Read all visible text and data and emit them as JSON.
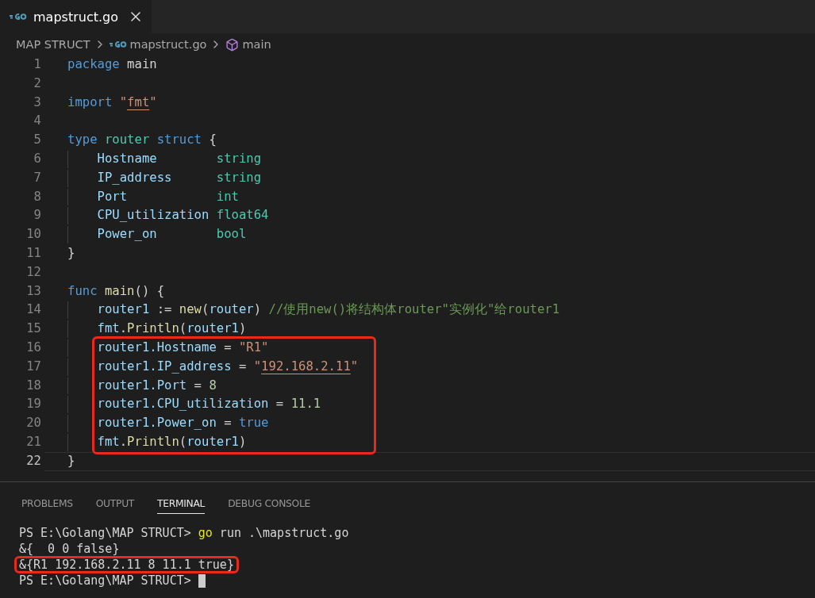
{
  "editor_tabs": [
    {
      "label": "mapstruct.go",
      "selected": true
    }
  ],
  "breadcrumb": [
    {
      "kind": "folder",
      "label": "MAP STRUCT"
    },
    {
      "kind": "file",
      "label": "mapstruct.go"
    },
    {
      "kind": "symbol",
      "label": "main"
    }
  ],
  "code_lines": [
    {
      "number": "1",
      "current": false,
      "highlighted": false,
      "tokens": [
        {
          "kind": "kw",
          "text": "package"
        },
        {
          "kind": "plain",
          "text": " main"
        }
      ]
    },
    {
      "number": "2",
      "current": false,
      "highlighted": false
    },
    {
      "number": "3",
      "current": false,
      "highlighted": false,
      "tokens": [
        {
          "kind": "kw",
          "text": "import "
        },
        {
          "kind": "str",
          "text": "\""
        },
        {
          "kind": "link",
          "text": "fmt"
        },
        {
          "kind": "str",
          "text": "\""
        }
      ]
    },
    {
      "number": "4",
      "current": false,
      "highlighted": false
    },
    {
      "number": "5",
      "current": false,
      "highlighted": false,
      "tokens": [
        {
          "kind": "kw",
          "text": "type "
        },
        {
          "kind": "type",
          "text": "router "
        },
        {
          "kind": "kw",
          "text": "struct"
        },
        {
          "kind": "plain",
          "text": " {"
        }
      ]
    },
    {
      "number": "6",
      "current": false,
      "highlighted": false,
      "tokens": [
        {
          "kind": "var",
          "text": "    Hostname        "
        },
        {
          "kind": "type",
          "text": "string"
        }
      ]
    },
    {
      "number": "7",
      "current": false,
      "highlighted": false,
      "tokens": [
        {
          "kind": "var",
          "text": "    IP_address      "
        },
        {
          "kind": "type",
          "text": "string"
        }
      ]
    },
    {
      "number": "8",
      "current": false,
      "highlighted": false,
      "tokens": [
        {
          "kind": "var",
          "text": "    Port            "
        },
        {
          "kind": "type",
          "text": "int"
        }
      ]
    },
    {
      "number": "9",
      "current": false,
      "highlighted": false,
      "tokens": [
        {
          "kind": "var",
          "text": "    CPU_utilization "
        },
        {
          "kind": "type",
          "text": "float64"
        }
      ]
    },
    {
      "number": "10",
      "current": false,
      "highlighted": false,
      "tokens": [
        {
          "kind": "var",
          "text": "    Power_on        "
        },
        {
          "kind": "type",
          "text": "bool"
        }
      ]
    },
    {
      "number": "11",
      "current": false,
      "highlighted": false,
      "tokens": [
        {
          "kind": "plain",
          "text": "}"
        }
      ]
    },
    {
      "number": "12",
      "current": false,
      "highlighted": false
    },
    {
      "number": "13",
      "current": false,
      "highlighted": false,
      "tokens": [
        {
          "kind": "kw",
          "text": "func "
        },
        {
          "kind": "fn",
          "text": "main"
        },
        {
          "kind": "plain",
          "text": "() {"
        }
      ]
    },
    {
      "number": "14",
      "current": false,
      "highlighted": false,
      "tokens": [
        {
          "kind": "var",
          "text": "    router1"
        },
        {
          "kind": "plain",
          "text": " := "
        },
        {
          "kind": "fn",
          "text": "new"
        },
        {
          "kind": "plain",
          "text": "("
        },
        {
          "kind": "var",
          "text": "router"
        },
        {
          "kind": "plain",
          "text": ") "
        },
        {
          "kind": "comment",
          "text": "//使用new()将结构体router\"实例化\"给router1"
        }
      ]
    },
    {
      "number": "15",
      "current": false,
      "highlighted": false,
      "tokens": [
        {
          "kind": "var",
          "text": "    fmt"
        },
        {
          "kind": "plain",
          "text": "."
        },
        {
          "kind": "fn",
          "text": "Println"
        },
        {
          "kind": "plain",
          "text": "("
        },
        {
          "kind": "var",
          "text": "router1"
        },
        {
          "kind": "plain",
          "text": ")"
        }
      ]
    },
    {
      "number": "16",
      "current": false,
      "highlighted": true,
      "tokens": [
        {
          "kind": "var",
          "text": "    router1.Hostname"
        },
        {
          "kind": "plain",
          "text": " = "
        },
        {
          "kind": "str",
          "text": "\"R1\""
        }
      ]
    },
    {
      "number": "17",
      "current": false,
      "highlighted": true,
      "tokens": [
        {
          "kind": "var",
          "text": "    router1.IP_address"
        },
        {
          "kind": "plain",
          "text": " = "
        },
        {
          "kind": "str",
          "text": "\""
        },
        {
          "kind": "link",
          "text": "192.168.2.11"
        },
        {
          "kind": "str",
          "text": "\""
        }
      ]
    },
    {
      "number": "18",
      "current": false,
      "highlighted": true,
      "tokens": [
        {
          "kind": "var",
          "text": "    router1.Port"
        },
        {
          "kind": "plain",
          "text": " = "
        },
        {
          "kind": "num",
          "text": "8"
        }
      ]
    },
    {
      "number": "19",
      "current": false,
      "highlighted": true,
      "tokens": [
        {
          "kind": "var",
          "text": "    router1.CPU_utilization"
        },
        {
          "kind": "plain",
          "text": " = "
        },
        {
          "kind": "num",
          "text": "11.1"
        }
      ]
    },
    {
      "number": "20",
      "current": false,
      "highlighted": true,
      "tokens": [
        {
          "kind": "var",
          "text": "    router1.Power_on"
        },
        {
          "kind": "plain",
          "text": " = "
        },
        {
          "kind": "kw",
          "text": "true"
        }
      ]
    },
    {
      "number": "21",
      "current": false,
      "highlighted": true,
      "tokens": [
        {
          "kind": "var",
          "text": "    fmt"
        },
        {
          "kind": "plain",
          "text": "."
        },
        {
          "kind": "fn",
          "text": "Println"
        },
        {
          "kind": "plain",
          "text": "("
        },
        {
          "kind": "var",
          "text": "router1"
        },
        {
          "kind": "plain",
          "text": ")"
        }
      ]
    },
    {
      "number": "22",
      "current": true,
      "highlighted": false,
      "tokens": [
        {
          "kind": "plain",
          "text": "}"
        }
      ]
    }
  ],
  "panel_tabs": [
    {
      "label": "PROBLEMS",
      "selected": false
    },
    {
      "label": "OUTPUT",
      "selected": false
    },
    {
      "label": "TERMINAL",
      "selected": true
    },
    {
      "label": "DEBUG CONSOLE",
      "selected": false
    }
  ],
  "terminal_lines": [
    {
      "highlighted": false,
      "cursor": false,
      "tokens": [
        {
          "kind": "plain",
          "text": "PS E:\\Golang\\MAP STRUCT> "
        },
        {
          "kind": "cmd",
          "text": "go"
        },
        {
          "kind": "plain",
          "text": " run .\\mapstruct.go"
        }
      ]
    },
    {
      "highlighted": false,
      "cursor": false,
      "tokens": [
        {
          "kind": "plain",
          "text": "&{  0 0 false}"
        }
      ]
    },
    {
      "highlighted": true,
      "cursor": false,
      "tokens": [
        {
          "kind": "plain",
          "text": "&{R1 192.168.2.11 8 11.1 true}"
        }
      ]
    },
    {
      "highlighted": false,
      "cursor": true,
      "tokens": [
        {
          "kind": "plain",
          "text": "PS E:\\Golang\\MAP STRUCT> "
        }
      ]
    }
  ]
}
